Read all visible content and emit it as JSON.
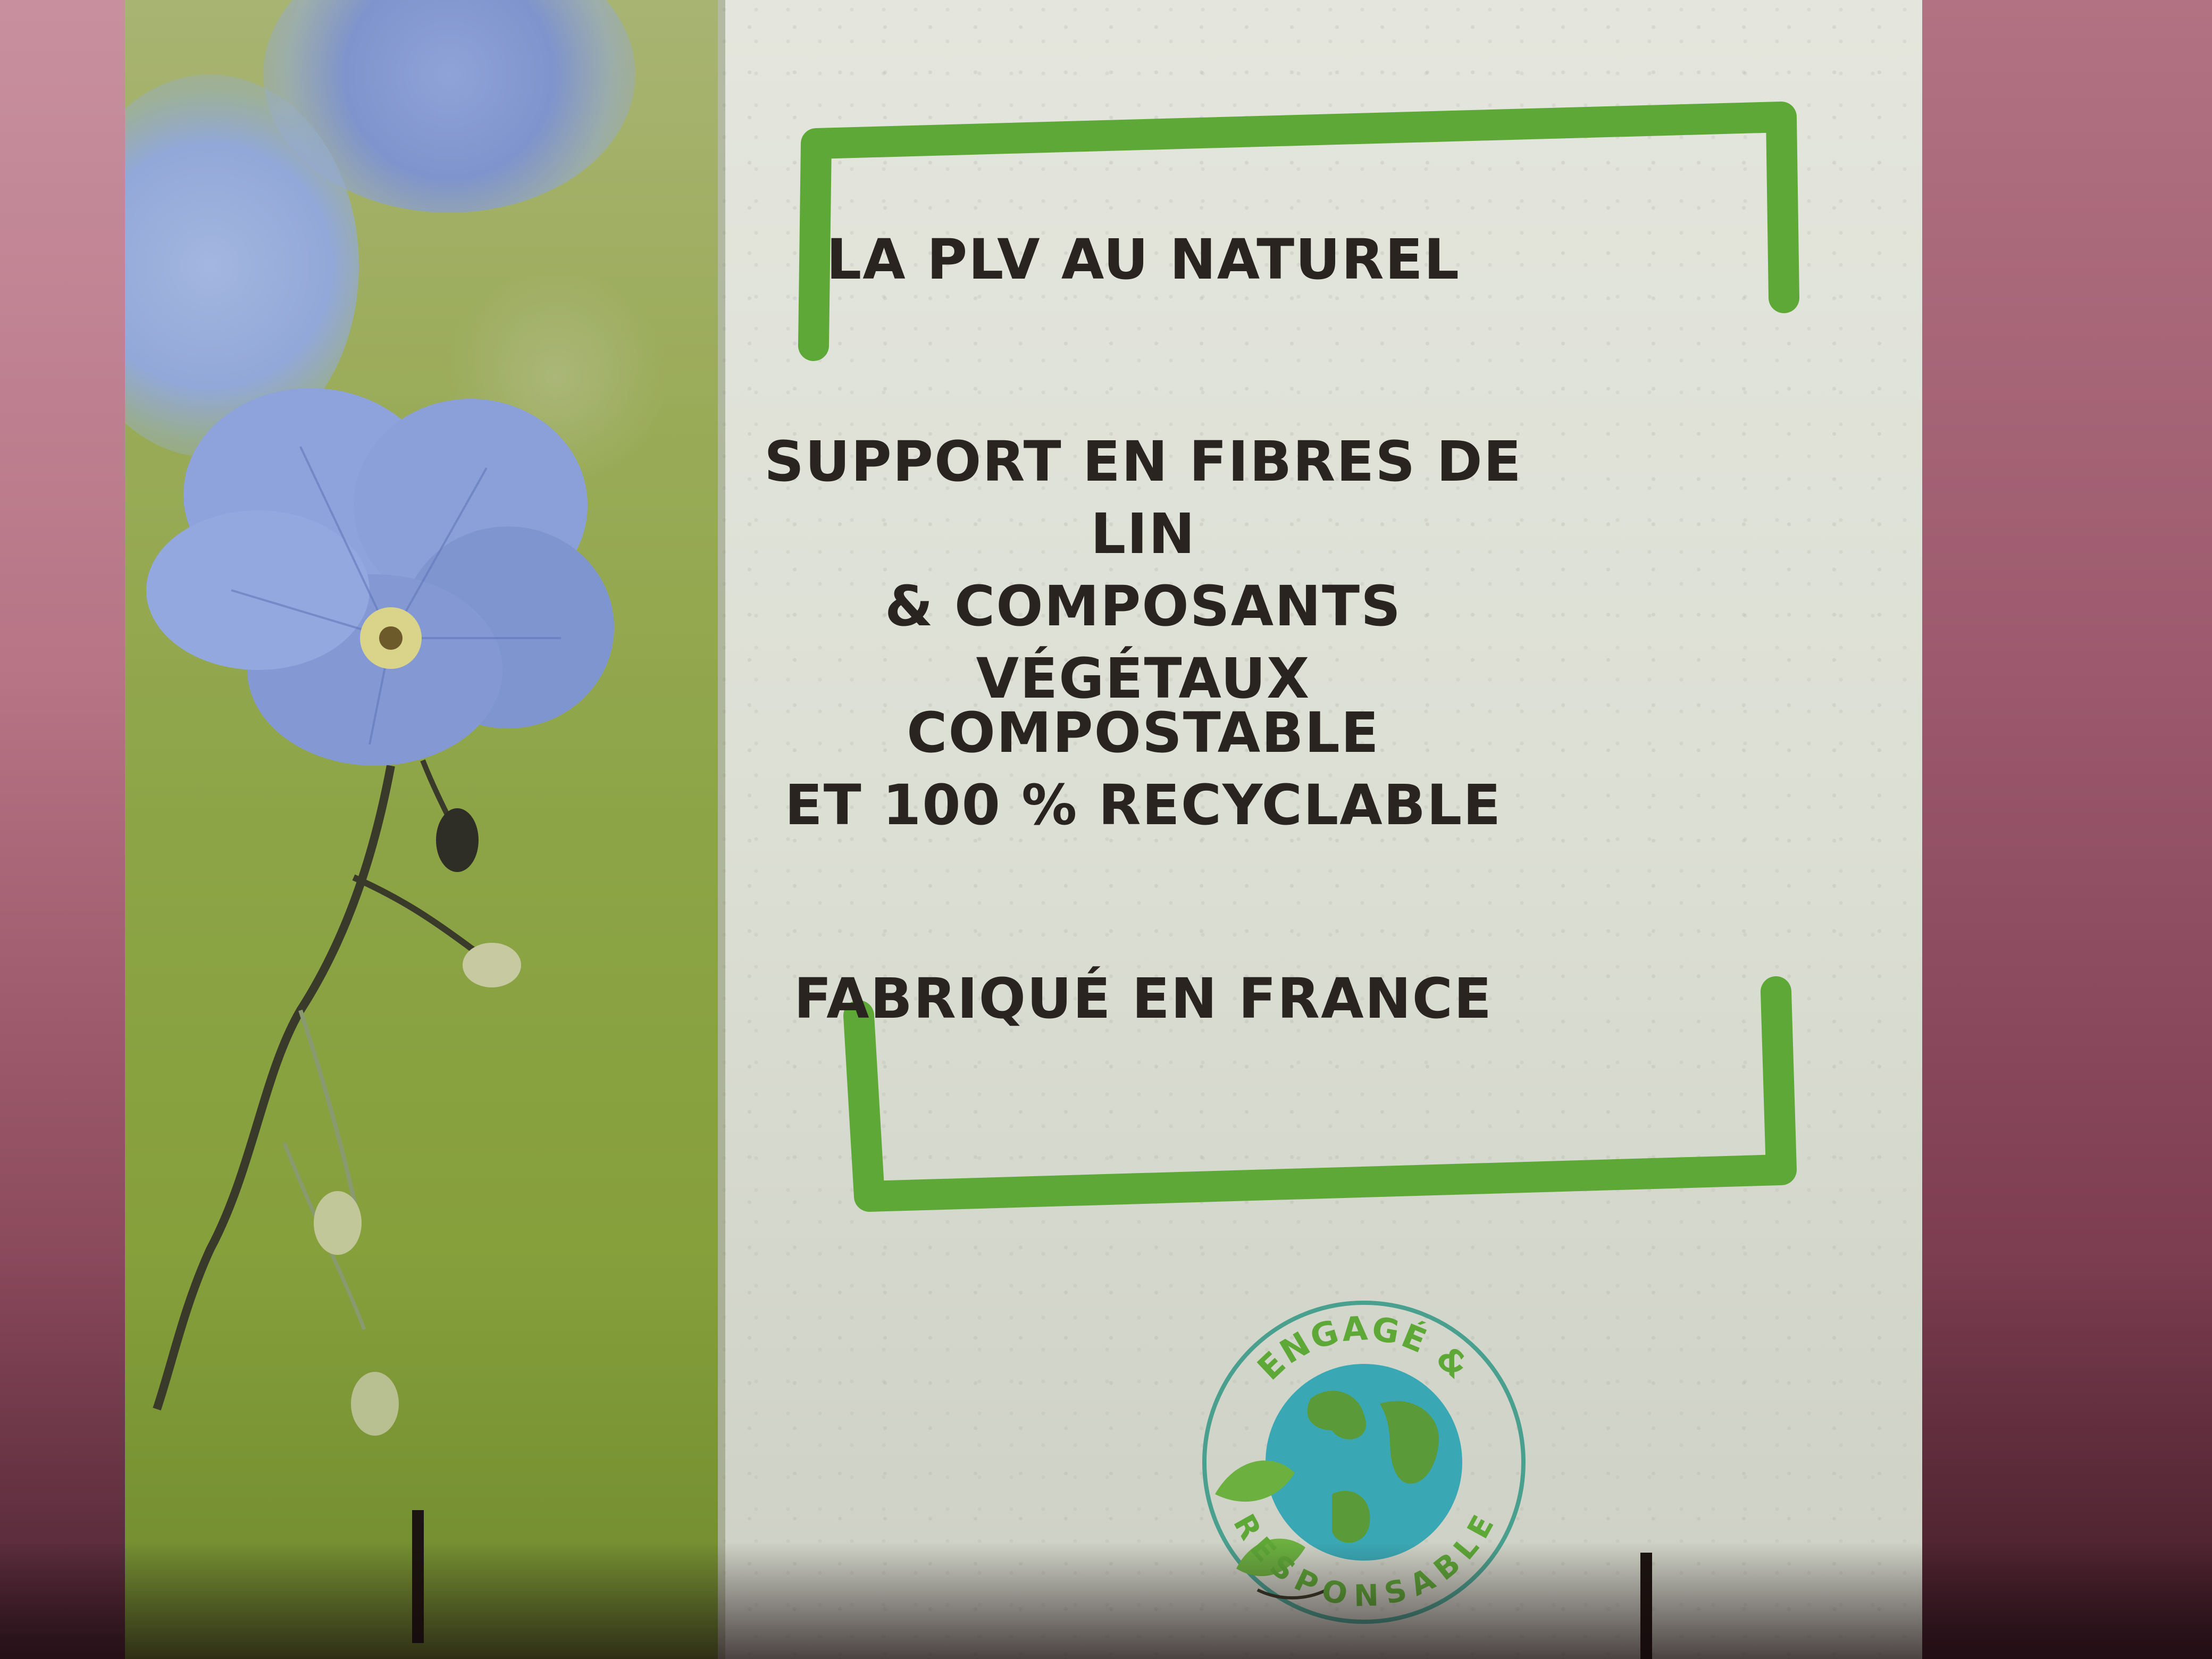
{
  "sign": {
    "heading": "LA PLV AU NATUREL",
    "support": {
      "line1": "SUPPORT EN FIBRES DE LIN",
      "line2": "& COMPOSANTS VÉGÉTAUX"
    },
    "compost": {
      "line1": "COMPOSTABLE",
      "line2": "ET 100 % RECYCLABLE"
    },
    "origin": "FABRIQUÉ EN FRANCE",
    "badge": {
      "top_text": "ENGAGÉ &",
      "bottom_text": "RESPONSABLE",
      "icon": "earth-globe-with-leaves"
    },
    "colors": {
      "frame_green": "#5ea838",
      "text": "#2a2420",
      "flower_blue": "#7f98d6",
      "panel": "#dfe1d7"
    }
  }
}
